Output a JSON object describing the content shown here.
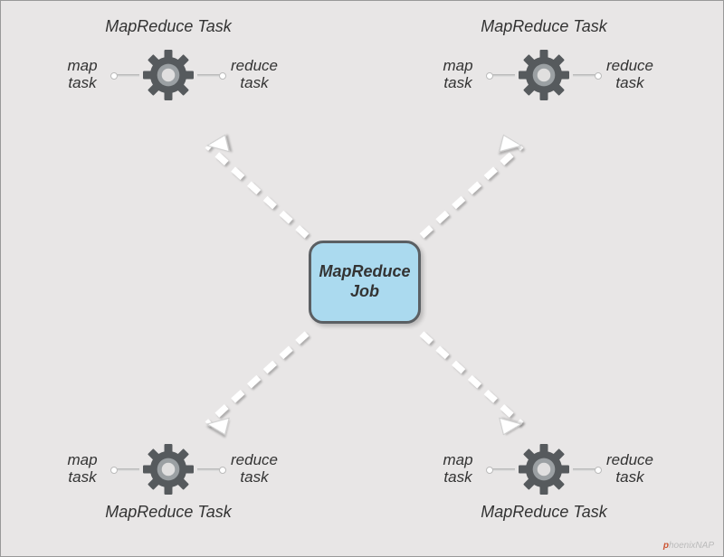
{
  "diagram": {
    "central": {
      "label_line1": "MapReduce",
      "label_line2": "Job"
    },
    "nodes": {
      "top_left": {
        "title": "MapReduce Task",
        "left_label_l1": "map",
        "left_label_l2": "task",
        "right_label_l1": "reduce",
        "right_label_l2": "task"
      },
      "top_right": {
        "title": "MapReduce Task",
        "left_label_l1": "map",
        "left_label_l2": "task",
        "right_label_l1": "reduce",
        "right_label_l2": "task"
      },
      "bottom_left": {
        "title": "MapReduce Task",
        "left_label_l1": "map",
        "left_label_l2": "task",
        "right_label_l1": "reduce",
        "right_label_l2": "task"
      },
      "bottom_right": {
        "title": "MapReduce Task",
        "left_label_l1": "map",
        "left_label_l2": "task",
        "right_label_l1": "reduce",
        "right_label_l2": "task"
      }
    },
    "watermark": "phoenixNAP",
    "colors": {
      "bg": "#e8e6e6",
      "central_fill": "#abdaef",
      "central_border": "#5b5f63",
      "gear_dark": "#565a5d",
      "gear_light": "#9ba0a3"
    }
  }
}
